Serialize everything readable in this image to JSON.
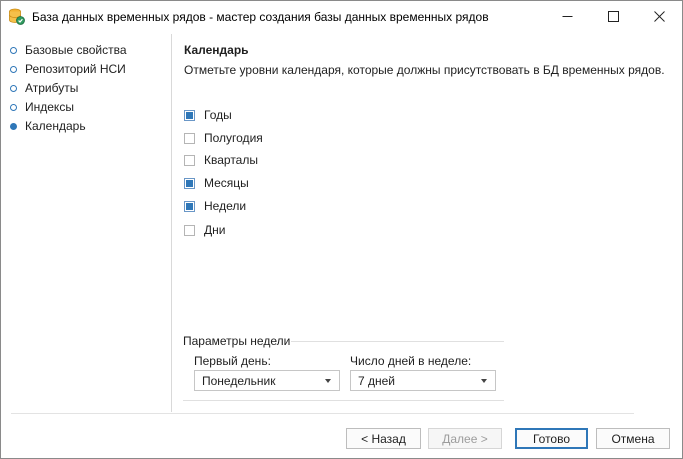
{
  "window": {
    "title": "База данных временных рядов - мастер создания базы данных временных рядов"
  },
  "sidebar": {
    "items": [
      {
        "label": "Базовые свойства",
        "active": false
      },
      {
        "label": "Репозиторий НСИ",
        "active": false
      },
      {
        "label": "Атрибуты",
        "active": false
      },
      {
        "label": "Индексы",
        "active": false
      },
      {
        "label": "Календарь",
        "active": true
      }
    ]
  },
  "main": {
    "heading": "Календарь",
    "description": "Отметьте уровни календаря, которые должны присутствовать в БД временных рядов.",
    "levels": [
      {
        "label": "Годы",
        "checked": true
      },
      {
        "label": "Полугодия",
        "checked": false
      },
      {
        "label": "Кварталы",
        "checked": false
      },
      {
        "label": "Месяцы",
        "checked": true
      },
      {
        "label": "Недели",
        "checked": true
      },
      {
        "label": "Дни",
        "checked": false
      }
    ],
    "week_params": {
      "group_title": "Параметры недели",
      "first_day_label": "Первый день:",
      "first_day_value": "Понедельник",
      "days_label": "Число дней в неделе:",
      "days_value": "7 дней"
    }
  },
  "footer": {
    "back_label": "< Назад",
    "next_label": "Далее >",
    "finish_label": "Готово",
    "cancel_label": "Отмена"
  },
  "colors": {
    "accent": "#2f77b8"
  },
  "icons": {
    "app": "database-icon",
    "minimize": "minimize-icon",
    "maximize": "maximize-icon",
    "close": "close-icon"
  }
}
